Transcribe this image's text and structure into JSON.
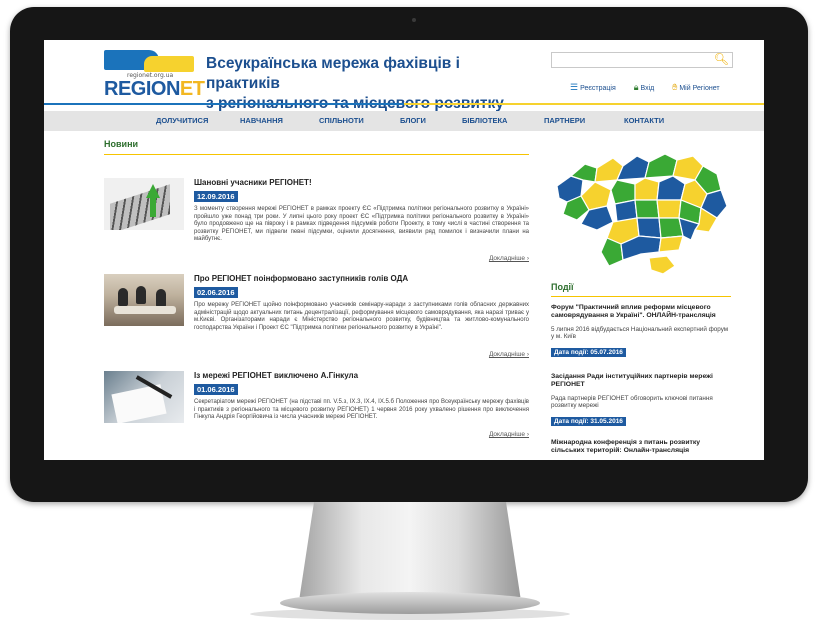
{
  "header": {
    "logo_url": "regionet.org.ua",
    "logo_part1": "REGION",
    "logo_part2": "ET",
    "title_line1": "Всеукраїнська мережа фахівців і практиків",
    "title_line2": "з регіонального та місцевого розвитку",
    "search": {
      "value": "",
      "placeholder": ""
    },
    "links": {
      "register": "Реєстрація",
      "login": "Вхід",
      "my": "Мій Регіонет"
    }
  },
  "nav": {
    "items": [
      "ДОЛУЧИТИСЯ",
      "НАВЧАННЯ",
      "СПІЛЬНОТИ",
      "БЛОГИ",
      "БІБЛІОТЕКА",
      "ПАРТНЕРИ",
      "КОНТАКТИ"
    ]
  },
  "news": {
    "heading": "Новини",
    "more_label": "Докладніше ›",
    "items": [
      {
        "title": "Шановні учасники РЕГІОНЕТ!",
        "date": "12.09.2016",
        "text": "З моменту створення мережі РЕГІОНЕТ в рамках проекту ЄС «Підтримка політики регіонального розвитку в Україні» пройшло уже понад три роки. У липні цього року проект ЄС «Підтримка політики регіонального розвитку в Україні» було продовжено ще на півроку і в рамках підведення підсумків роботи Проекту, в тому числі в частині створення та розвитку РЕГІОНЕТ, ми підвели певні підсумки, оцінили досягнення, виявили ряд помилок і визначили плани на майбутнє."
      },
      {
        "title": "Про РЕГІОНЕТ поінформовано заступників голів ОДА",
        "date": "02.06.2016",
        "text": "Про мережу РЕГІОНЕТ щойно поінформовано учасників семінару-наради з заступниками голів обласних державних адміністрацій щодо актуальних питань децентралізації, реформування місцевого самоврядування, яка наразі триває у м.Києві. Організаторами наради є Міністерство регіонального розвитку, будівництва та житлово-комунального господарства України і Проект ЄС \"Підтримка політики регіонального розвитку в Україні\"."
      },
      {
        "title": "Із мережі РЕГІОНЕТ виключено А.Гінкула",
        "date": "01.06.2016",
        "text": "Секретаріатом мережі РЕГІОНЕТ (на підставі пп. V.5.з, ІХ.3, ІХ.4, ІХ.5.б Положення про Всеукраїнську мережу фахівців і практиків з регіонального та місцевого розвитку РЕГІОНЕТ) 1 червня 2016 року ухвалено рішення про виключення Гінкула Андрія Георгійовича із числа учасників мережі РЕГІОНЕТ."
      }
    ]
  },
  "events": {
    "heading": "Події",
    "items": [
      {
        "title": "Форум \"Практичний вплив реформи місцевого самоврядування в Україні\". ОНЛАЙН-трансляція",
        "desc": "5 липня 2016 відбудається Національний експертний форум у м. Київ",
        "date": "Дата події: 05.07.2016"
      },
      {
        "title": "Засідання Ради інституційних партнерів мережі РЕГІОНЕТ",
        "desc": "Рада партнерів РЕГІОНЕТ обговорить ключові питання розвитку мережі",
        "date": "Дата події: 31.05.2016"
      },
      {
        "title": "Міжнародна конференція з питань розвитку сільських територій: Онлайн-трансляція",
        "desc": "",
        "date": ""
      }
    ]
  },
  "colors": {
    "brand_blue": "#1e5aa0",
    "brand_yellow": "#f6d22e",
    "heading_green": "#2d6e2d",
    "map_green": "#3aa935"
  }
}
